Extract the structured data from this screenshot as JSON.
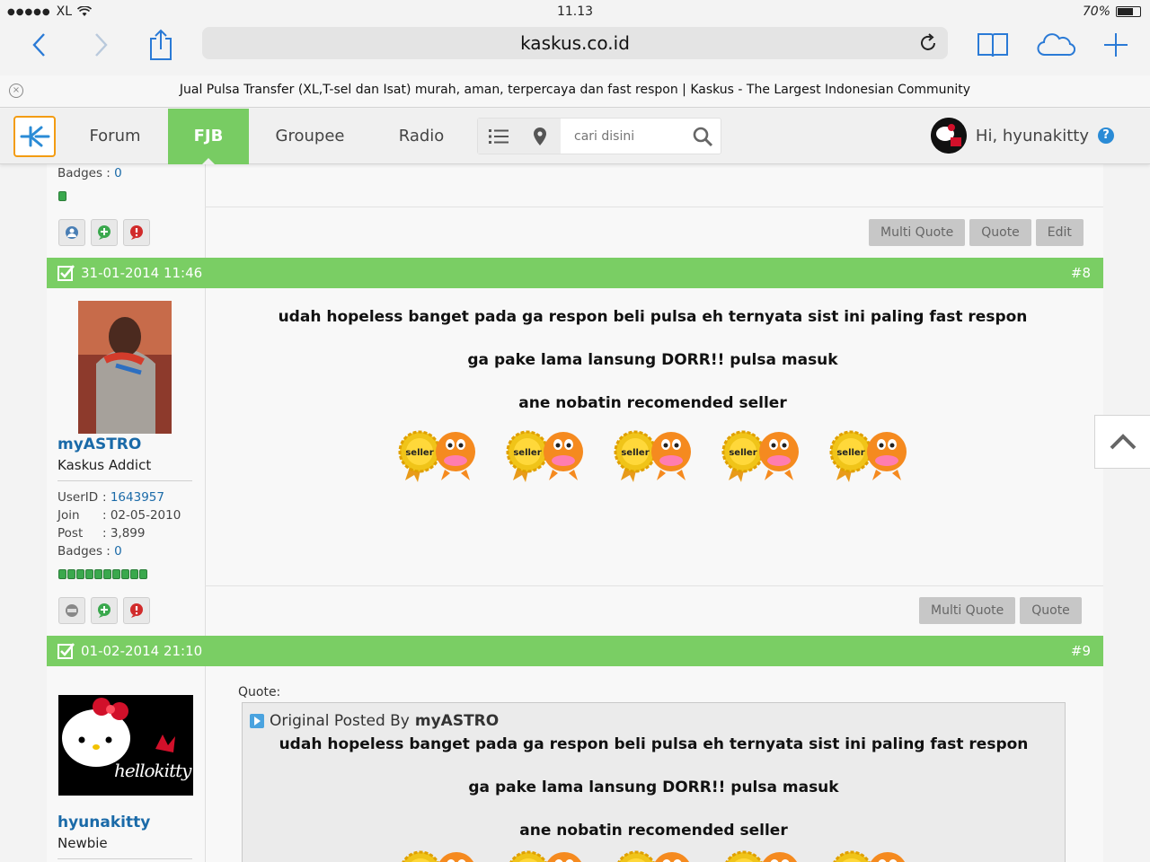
{
  "status_bar": {
    "carrier": "XL",
    "time": "11.13",
    "battery": "70%",
    "battery_level": 0.7
  },
  "browser": {
    "url": "kaskus.co.id",
    "tab_title": "Jual Pulsa Transfer (XL,T-sel dan Isat) murah, aman, terpercaya dan fast respon | Kaskus - The Largest Indonesian Community"
  },
  "nav": {
    "items": [
      {
        "label": "Forum",
        "active": false
      },
      {
        "label": "FJB",
        "active": true
      },
      {
        "label": "Groupee",
        "active": false
      },
      {
        "label": "Radio",
        "active": false
      }
    ],
    "search_placeholder": "cari disini",
    "greeting": "Hi, hyunakitty",
    "help": "?"
  },
  "prev_post": {
    "badges_label": "Badges :",
    "badges_value": "0",
    "buttons": [
      "Multi Quote",
      "Quote",
      "Edit"
    ]
  },
  "posts": [
    {
      "date": "31-01-2014 11:46",
      "number": "#8",
      "username": "myASTRO",
      "rank": "Kaskus Addict",
      "user_id_label": "UserID",
      "user_id": "1643957",
      "join_label": "Join",
      "join": ": 02-05-2010",
      "post_label": "Post",
      "post_count": ": 3,899",
      "badges_label": "Badges :",
      "badges": "0",
      "lines": [
        "udah hopeless banget pada ga respon beli pulsa eh ternyata sist ini paling fast respon",
        "ga pake lama lansung DORR!! pulsa masuk",
        "ane nobatin recomended seller"
      ],
      "seller_label": "seller",
      "buttons": [
        "Multi Quote",
        "Quote"
      ]
    },
    {
      "date": "01-02-2014 21:10",
      "number": "#9",
      "username": "hyunakitty",
      "rank": "Newbie",
      "avatar_text": "hellokitty",
      "quote_label": "Quote:",
      "quote_prefix": "Original Posted By",
      "quote_author": "myASTRO",
      "quote_lines": [
        "udah hopeless banget pada ga respon beli pulsa eh ternyata sist ini paling fast respon",
        "ga pake lama lansung DORR!! pulsa masuk",
        "ane nobatin recomended seller"
      ]
    }
  ]
}
